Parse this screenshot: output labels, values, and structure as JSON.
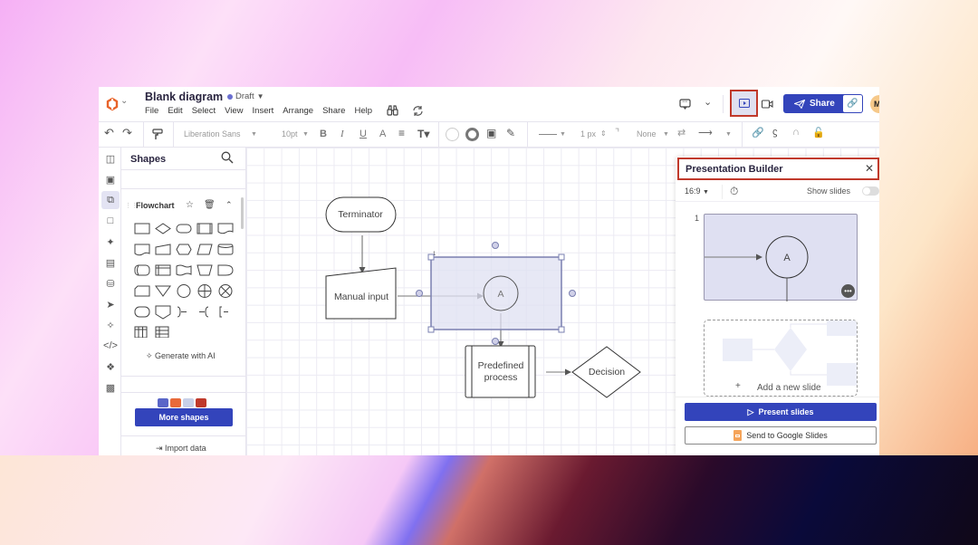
{
  "app": {
    "title": "Blank diagram",
    "status": "Draft",
    "menu": [
      "File",
      "Edit",
      "Select",
      "View",
      "Insert",
      "Arrange",
      "Share",
      "Help"
    ]
  },
  "topbar": {
    "share_label": "Share",
    "avatar_initial": "M"
  },
  "toolbar": {
    "font_family": "Liberation Sans",
    "font_size": "10pt",
    "line_width": "1 px",
    "arrow_start": "None"
  },
  "shapes_panel": {
    "title": "Shapes",
    "section_title": "Flowchart",
    "generate_ai_label": "Generate with AI",
    "more_shapes_label": "More shapes",
    "import_data_label": "Import data"
  },
  "canvas": {
    "nodes": {
      "terminator": "Terminator",
      "manual_input": "Manual input",
      "connector": "A",
      "predefined_process_line1": "Predefined",
      "predefined_process_line2": "process",
      "decision": "Decision",
      "selection_badge": "1"
    }
  },
  "presentation_builder": {
    "title": "Presentation Builder",
    "aspect_ratio": "16:9",
    "show_slides_label": "Show slides",
    "show_slides_on": false,
    "slide_number": "1",
    "slide_label": "A",
    "add_slide_label": "Add a new slide",
    "present_label": "Present slides",
    "google_slides_label": "Send to Google Slides"
  },
  "colors": {
    "accent": "#3344bb",
    "highlight": "#c0392b",
    "selection_fill": "#dfe0f2"
  }
}
